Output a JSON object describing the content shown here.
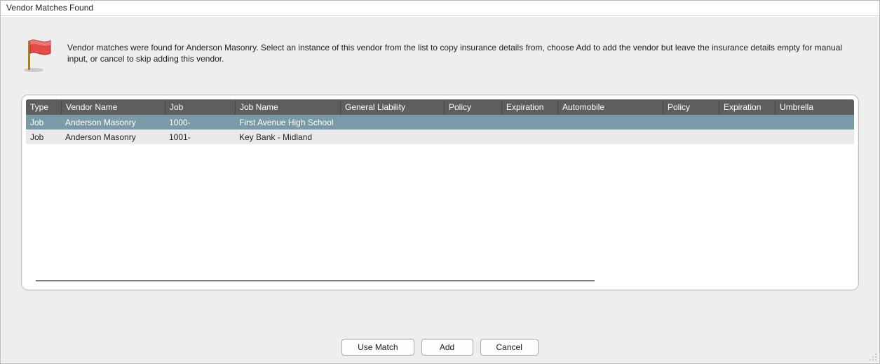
{
  "window": {
    "title": "Vendor Matches Found"
  },
  "message": {
    "text": "Vendor matches were found for Anderson Masonry.  Select an instance of this vendor from the list to copy insurance details from, choose Add to add the vendor but leave the insurance details empty for manual input, or cancel to skip adding this vendor."
  },
  "icon": {
    "name": "red-flag-icon",
    "color": "#e34a4a"
  },
  "grid": {
    "columns": [
      "Type",
      "Vendor Name",
      "Job",
      "Job Name",
      "General Liability",
      "Policy",
      "Expiration",
      "Automobile",
      "Policy",
      "Expiration",
      "Umbrella"
    ],
    "rows": [
      {
        "selected": true,
        "cells": [
          "Job",
          "Anderson Masonry",
          "1000-",
          "First Avenue High School",
          "",
          "",
          "",
          "",
          "",
          "",
          ""
        ]
      },
      {
        "selected": false,
        "cells": [
          "Job",
          "Anderson Masonry",
          "1001-",
          "Key Bank - Midland",
          "",
          "",
          "",
          "",
          "",
          "",
          ""
        ]
      }
    ]
  },
  "buttons": {
    "use_match": "Use Match",
    "add": "Add",
    "cancel": "Cancel"
  }
}
